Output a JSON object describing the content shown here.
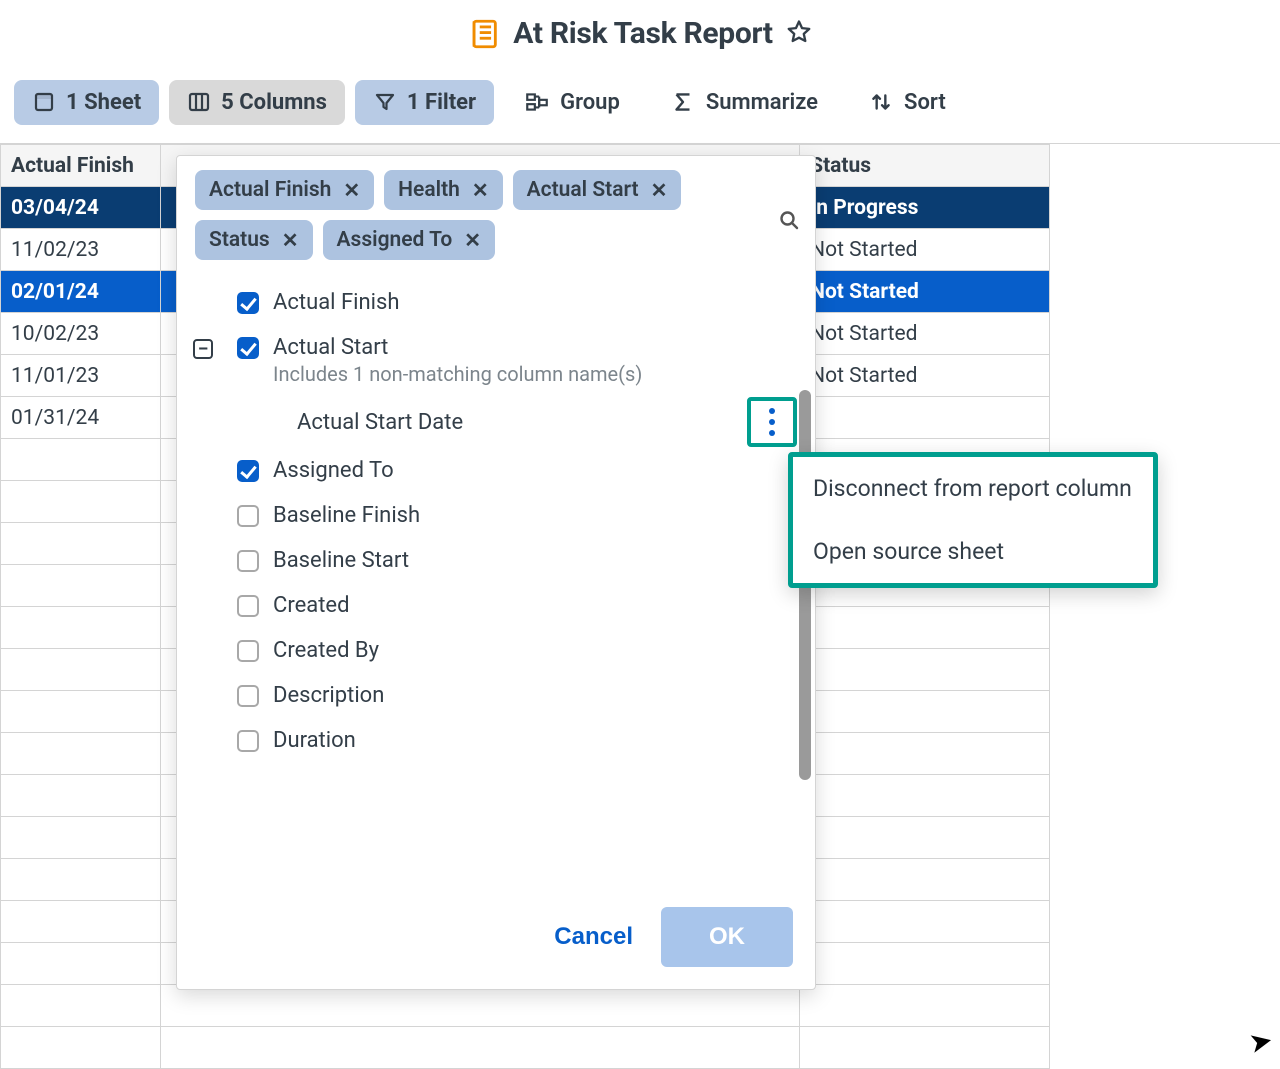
{
  "header": {
    "title": "At Risk Task Report"
  },
  "toolbar": {
    "sheet": {
      "label": "1 Sheet"
    },
    "columns": {
      "label": "5 Columns"
    },
    "filter": {
      "label": "1 Filter"
    },
    "group": {
      "label": "Group"
    },
    "summarize": {
      "label": "Summarize"
    },
    "sort": {
      "label": "Sort"
    }
  },
  "grid_headers": {
    "finish": "Actual Finish",
    "status": "Status"
  },
  "rows": [
    {
      "finish": "03/04/24",
      "status": "In Progress",
      "style": "dark"
    },
    {
      "finish": "11/02/23",
      "status": "Not Started",
      "style": ""
    },
    {
      "finish": "02/01/24",
      "status": "Not Started",
      "style": "blue"
    },
    {
      "finish": "10/02/23",
      "status": "Not Started",
      "style": ""
    },
    {
      "finish": "11/01/23",
      "status": "Not Started",
      "style": ""
    },
    {
      "finish": "01/31/24",
      "status": "",
      "style": ""
    }
  ],
  "chips": [
    "Actual Finish",
    "Health",
    "Actual Start",
    "Status",
    "Assigned To"
  ],
  "column_options": [
    {
      "label": "Actual Finish",
      "checked": true
    },
    {
      "label": "Actual Start",
      "checked": true,
      "expandable": true,
      "sub": "Includes 1 non-matching column name(s)",
      "child": "Actual Start Date"
    },
    {
      "label": "Assigned To",
      "checked": true
    },
    {
      "label": "Baseline Finish",
      "checked": false
    },
    {
      "label": "Baseline Start",
      "checked": false
    },
    {
      "label": "Created",
      "checked": false
    },
    {
      "label": "Created By",
      "checked": false
    },
    {
      "label": "Description",
      "checked": false
    },
    {
      "label": "Duration",
      "checked": false
    }
  ],
  "picker_buttons": {
    "cancel": "Cancel",
    "ok": "OK"
  },
  "context_menu": {
    "items": [
      "Disconnect from report column",
      "Open source sheet"
    ]
  }
}
